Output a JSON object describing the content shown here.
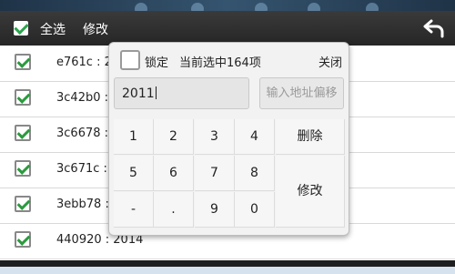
{
  "action_bar": {
    "select_all": "全选",
    "edit": "修改"
  },
  "list": {
    "rows": [
      {
        "text": "e761c : 2"
      },
      {
        "text": "3c42b0 :"
      },
      {
        "text": "3c6678 :"
      },
      {
        "text": "3c671c :"
      },
      {
        "text": "3ebb78 :"
      },
      {
        "text": "440920 : 2014"
      }
    ]
  },
  "popup": {
    "lock_label": "锁定",
    "selected_count_text": "当前选中164项",
    "close_label": "关闭",
    "address_value": "2011",
    "offset_placeholder": "输入地址偏移",
    "keys": {
      "k1": "1",
      "k2": "2",
      "k3": "3",
      "k4": "4",
      "k5": "5",
      "k6": "6",
      "k7": "7",
      "k8": "8",
      "minus": "-",
      "dot": ".",
      "k9": "9",
      "k0": "0",
      "delete": "删除",
      "modify": "修改"
    }
  }
}
